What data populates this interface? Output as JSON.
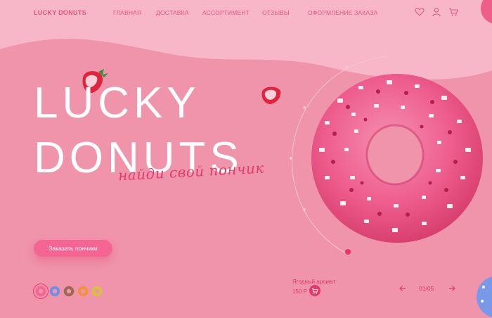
{
  "header": {
    "logo": "LUCKY DONUTS",
    "nav": [
      {
        "label": "ГЛАВНАЯ"
      },
      {
        "label": "ДОСТАВКА"
      },
      {
        "label": "АССОРТИМЕНТ"
      },
      {
        "label": "ОТЗЫВЫ"
      },
      {
        "label": "ОФОРМЛЕНИЕ ЗАКАЗА"
      }
    ],
    "icons": [
      "heart-icon",
      "user-icon",
      "cart-icon"
    ]
  },
  "hero": {
    "title_line1": "LUCKY",
    "title_line2": "DONUTS",
    "tagline": "найди свой пончик",
    "cta_label": "Заказать пончики"
  },
  "product": {
    "name": "Ягодный аромат",
    "price": "150 Р"
  },
  "slider": {
    "counter": "01/05",
    "thumbnails": [
      {
        "name": "pink-donut-thumb",
        "color": "#f46593"
      },
      {
        "name": "blue-donut-thumb",
        "color": "#6d8fe6"
      },
      {
        "name": "chocolate-donut-thumb",
        "color": "#9c6a4e"
      },
      {
        "name": "orange-donut-thumb",
        "color": "#f2923a"
      },
      {
        "name": "yellow-donut-thumb",
        "color": "#d6c33b"
      }
    ]
  },
  "colors": {
    "background": "#f094ac",
    "accent": "#e8356c",
    "text_accent": "#e0567d",
    "hero_text": "#ffffff"
  }
}
